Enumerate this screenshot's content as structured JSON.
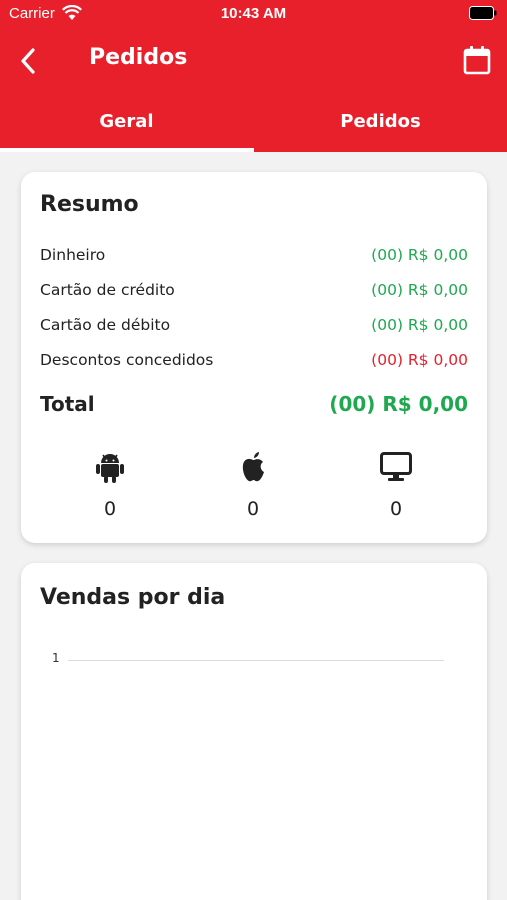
{
  "status_bar": {
    "carrier": "Carrier",
    "time": "10:43 AM"
  },
  "nav": {
    "title": "Pedidos"
  },
  "tabs": [
    {
      "label": "Geral",
      "selected": true
    },
    {
      "label": "Pedidos",
      "selected": false
    }
  ],
  "summary": {
    "title": "Resumo",
    "rows": [
      {
        "label": "Dinheiro",
        "value": "(00) R$ 0,00",
        "color": "#1ea84f"
      },
      {
        "label": "Cartão de crédito",
        "value": "(00) R$ 0,00",
        "color": "#1ea84f"
      },
      {
        "label": "Cartão de débito",
        "value": "(00) R$ 0,00",
        "color": "#1ea84f"
      },
      {
        "label": "Descontos concedidos",
        "value": "(00) R$ 0,00",
        "color": "#e8202c"
      }
    ],
    "total_label": "Total",
    "total_value": "(00) R$ 0,00",
    "platforms": [
      {
        "icon": "android-icon",
        "count": "0"
      },
      {
        "icon": "apple-icon",
        "count": "0"
      },
      {
        "icon": "desktop-icon",
        "count": "0"
      }
    ]
  },
  "chart": {
    "title": "Vendas por dia",
    "y_ticks": [
      "1"
    ]
  },
  "colors": {
    "brand_red": "#e8202c",
    "positive_green": "#1ea84f"
  }
}
